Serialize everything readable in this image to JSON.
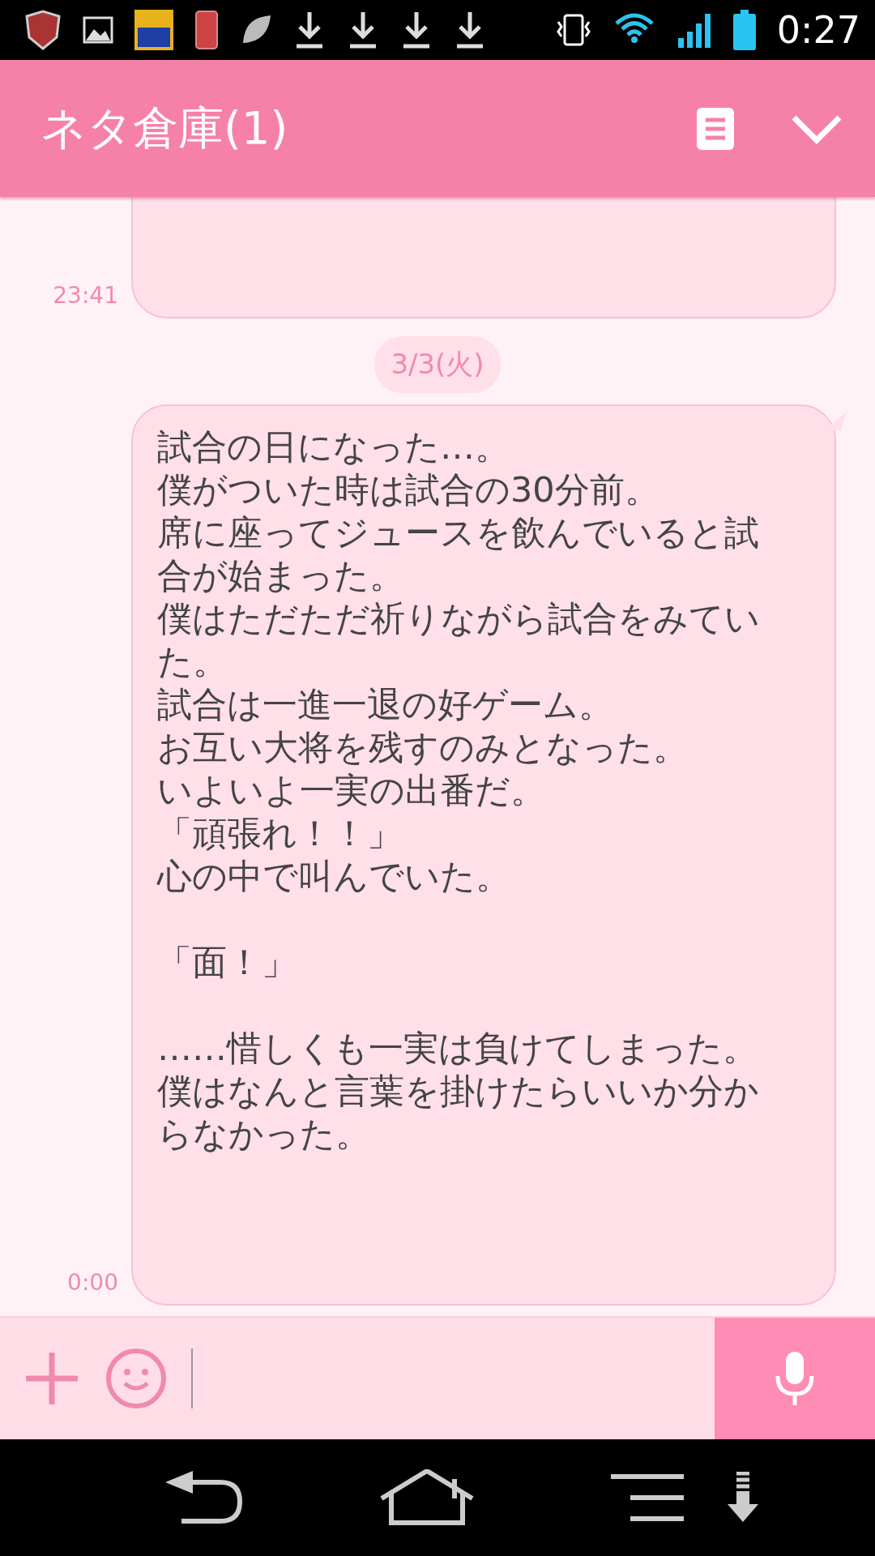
{
  "status_bar": {
    "time": "0:27"
  },
  "header": {
    "title": "ネタ倉庫(1)"
  },
  "messages": [
    {
      "kind": "bubble_partial",
      "time": "23:41"
    },
    {
      "kind": "date",
      "text": "3/3(火)"
    },
    {
      "kind": "bubble",
      "time": "0:00",
      "paragraphs": [
        [
          "試合の日になった…。",
          "僕がついた時は試合の30分前。",
          "席に座ってジュースを飲んでいると試合が始まった。",
          "僕はただただ祈りながら試合をみていた。",
          "試合は一進一退の好ゲーム。",
          "お互い大将を残すのみとなった。",
          "いよいよ一実の出番だ。",
          "「頑張れ！！」",
          "心の中で叫んでいた。"
        ],
        [
          "「面！」"
        ],
        [
          "……惜しくも一実は負けてしまった。",
          "僕はなんと言葉を掛けたらいいか分からなかった。"
        ]
      ]
    }
  ]
}
